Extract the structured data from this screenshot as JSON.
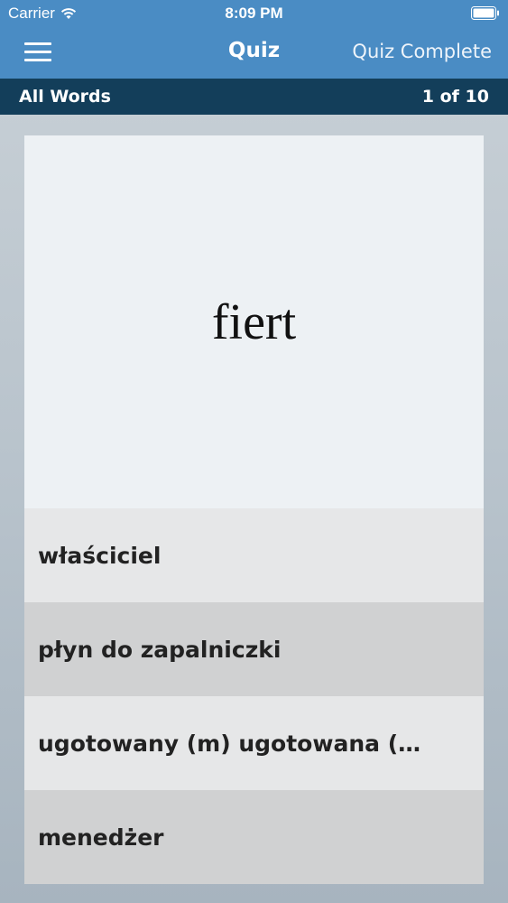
{
  "status_bar": {
    "carrier": "Carrier",
    "time": "8:09 PM",
    "wifi_icon": "wifi-icon",
    "battery_icon": "battery-icon"
  },
  "nav": {
    "menu_icon": "hamburger-menu-icon",
    "title": "Quiz",
    "right_button": "Quiz Complete"
  },
  "sub_bar": {
    "category": "All Words",
    "progress": "1 of 10"
  },
  "quiz": {
    "prompt_word": "fiert",
    "answers": [
      "właściciel",
      "płyn do zapalniczki",
      "ugotowany (m)  ugotowana (…",
      "menedżer"
    ]
  },
  "colors": {
    "nav_blue": "#4a8cc4",
    "sub_bar_navy": "#133e5a",
    "card_prompt_bg": "#edf1f4",
    "answer_light": "#e6e7e8",
    "answer_dark": "#d0d1d2"
  }
}
